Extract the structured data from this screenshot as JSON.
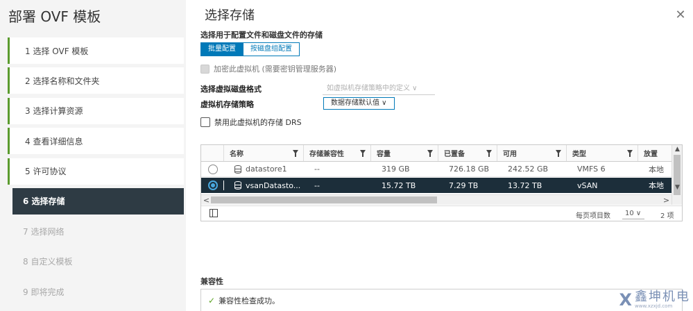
{
  "wizard": {
    "title": "部署 OVF 模板",
    "steps": [
      {
        "label": "1  选择 OVF 模板",
        "state": "done"
      },
      {
        "label": "2  选择名称和文件夹",
        "state": "done"
      },
      {
        "label": "3  选择计算资源",
        "state": "done"
      },
      {
        "label": "4  查看详细信息",
        "state": "done"
      },
      {
        "label": "5  许可协议",
        "state": "done"
      },
      {
        "label": "6  选择存储",
        "state": "active"
      },
      {
        "label": "7  选择网络",
        "state": "disabled"
      },
      {
        "label": "8  自定义模板",
        "state": "disabled"
      },
      {
        "label": "9  即将完成",
        "state": "disabled"
      }
    ]
  },
  "page": {
    "title": "选择存储",
    "close_glyph": "✕",
    "subtitle": "选择用于配置文件和磁盘文件的存储",
    "mode_batch": "批量配置",
    "mode_per_disk": "按磁盘组配置",
    "encrypt_label": "加密此虚拟机 (需要密钥管理服务器)",
    "disk_format_label": "选择虚拟磁盘格式",
    "disk_format_value": "如虚拟机存储策略中的定义 ∨",
    "policy_label": "虚拟机存储策略",
    "policy_value": "数据存储默认值 ∨",
    "drs_label": "禁用此虚拟机的存储 DRS"
  },
  "grid": {
    "columns": [
      "名称",
      "存储兼容性",
      "容量",
      "已置备",
      "可用",
      "类型",
      "放置"
    ],
    "rows": [
      {
        "name": "datastore1",
        "compat": "--",
        "capacity": "319 GB",
        "provisioned": "726.18 GB",
        "free": "242.52 GB",
        "type": "VMFS 6",
        "placement": "本地",
        "selected": false
      },
      {
        "name": "vsanDatasto...",
        "compat": "--",
        "capacity": "15.72 TB",
        "provisioned": "7.29 TB",
        "free": "13.72 TB",
        "type": "vSAN",
        "placement": "本地",
        "selected": true
      }
    ],
    "scroll_up": "▲",
    "scroll_down": "▼",
    "scroll_left": "<",
    "scroll_right": ">",
    "per_page_label": "每页项目数",
    "per_page_value": "10 ∨",
    "total": "2 项"
  },
  "compat": {
    "title": "兼容性",
    "check_glyph": "✓",
    "message": "兼容性检查成功。"
  },
  "watermark": {
    "logo_glyph": "Ⅹ",
    "text": "鑫坤机电",
    "url": "www.xzxjd.com"
  },
  "colors": {
    "accent": "#0079b8",
    "active_step_bg": "#2e3b44",
    "selected_row_bg": "#1c2e3a",
    "done_step_bar": "#5b9b2e",
    "success": "#5aa220"
  }
}
